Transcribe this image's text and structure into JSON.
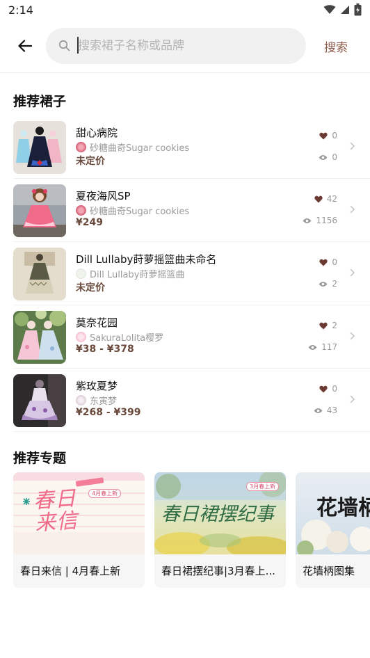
{
  "status": {
    "time": "2:14"
  },
  "search": {
    "placeholder": "搜索裙子名称或品牌",
    "action_label": "搜索"
  },
  "sections": {
    "dresses_title": "推荐裙子",
    "topics_title": "推荐专题"
  },
  "dresses": [
    {
      "name": "甜心病院",
      "brand": "砂糖曲奇Sugar cookies",
      "price": "未定价",
      "likes": "0",
      "views": "0"
    },
    {
      "name": "夏夜海风SP",
      "brand": "砂糖曲奇Sugar cookies",
      "price": "¥249",
      "likes": "42",
      "views": "1156"
    },
    {
      "name": "Dill Lullaby莳萝摇篮曲未命名",
      "brand": "Dill Lullaby莳萝摇篮曲",
      "price": "未定价",
      "likes": "0",
      "views": "2"
    },
    {
      "name": "莫奈花园",
      "brand": "SakuraLolita樱罗",
      "price": "¥38 - ¥378",
      "likes": "2",
      "views": "117"
    },
    {
      "name": "紫玫夏梦",
      "brand": "东寅梦",
      "price": "¥268 - ¥399",
      "likes": "0",
      "views": "43"
    }
  ],
  "topics": [
    {
      "title": "春日来信 | 4月春上新",
      "cover_text": "春日来信",
      "cover_tag": "4月春上新"
    },
    {
      "title": "春日裙摆纪事|3月春上...",
      "cover_text": "春日裙摆纪事",
      "cover_tag": "3月春上新"
    },
    {
      "title": "花墙柄图集",
      "cover_text": "花墙柄"
    }
  ],
  "colors": {
    "accent": "#8b5a4a",
    "price": "#6b4a3e",
    "like_heart": "#6b3b33"
  }
}
